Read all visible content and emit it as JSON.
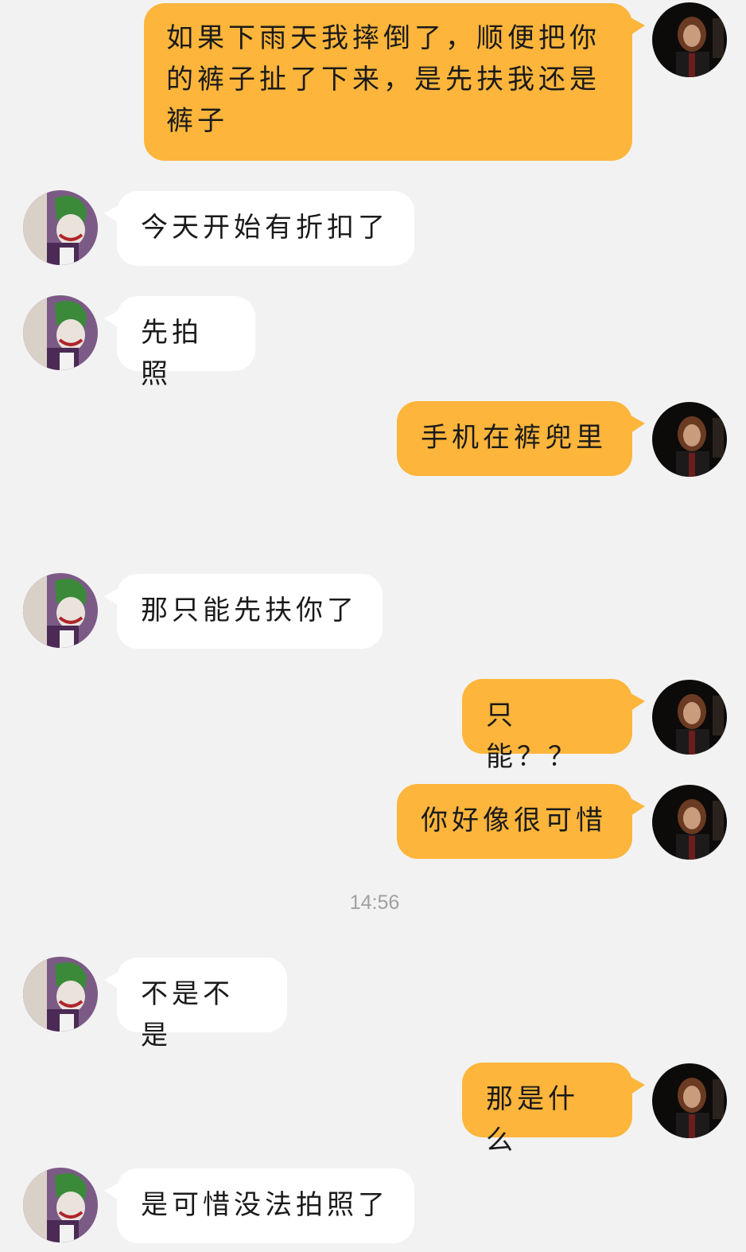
{
  "messages": [
    {
      "side": "out",
      "text": "如果下雨天我摔倒了，顺便把你的裤子扯了下来，是先扶我还是裤子"
    },
    {
      "side": "in",
      "text": "今天开始有折扣了"
    },
    {
      "side": "in",
      "text": "先拍照"
    },
    {
      "side": "out",
      "text": "手机在裤兜里"
    },
    {
      "side": "in",
      "text": "那只能先扶你了"
    },
    {
      "side": "out",
      "text": "只能？？"
    },
    {
      "side": "out",
      "text": "你好像很可惜"
    },
    {
      "side": "in",
      "text": "不是不是"
    },
    {
      "side": "out",
      "text": "那是什么"
    },
    {
      "side": "in",
      "text": "是可惜没法拍照了"
    }
  ],
  "timestamp": "14:56",
  "colors": {
    "background": "#f2f2f2",
    "outgoing_bubble": "#fdb53b",
    "incoming_bubble": "#ffffff",
    "timestamp_text": "#a0a0a0"
  },
  "avatars": {
    "incoming": "joker-comic-avatar",
    "outgoing": "girl-portrait-avatar"
  }
}
